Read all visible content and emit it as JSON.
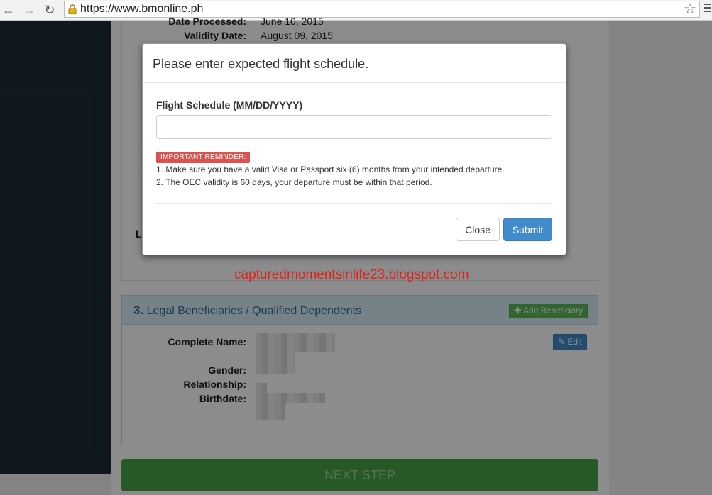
{
  "browser": {
    "url": "https://www.bmonline.ph"
  },
  "panel1": {
    "date_processed_label": "Date Processed:",
    "date_processed_value": "June 10, 2015",
    "validity_label": "Validity Date:",
    "validity_value": "August 09, 2015",
    "partial_label": "L"
  },
  "watermark": "capturedmomentsinlife23.blogspot.com",
  "beneficiaries": {
    "number": "3.",
    "title": "Legal Beneficiaries / Qualified Dependents",
    "add_label": "Add Beneficiary",
    "edit_label": "Edit",
    "fields": {
      "name": "Complete Name:",
      "gender": "Gender:",
      "relationship": "Relationship:",
      "birthdate": "Birthdate:"
    }
  },
  "next_step_label": "NEXT STEP",
  "modal": {
    "title": "Please enter expected flight schedule.",
    "field_label": "Flight Schedule (MM/DD/YYYY)",
    "field_value": "",
    "reminder_badge": "IMPORTANT REMINDER:",
    "notes": [
      "1. Make sure you have a valid Visa or Passport six (6) months from your intended departure.",
      "2. The OEC validity is 60 days, your departure must be within that period."
    ],
    "close_label": "Close",
    "submit_label": "Submit"
  },
  "icons": {
    "back": "arrow-left-icon",
    "forward": "arrow-right-icon",
    "reload": "reload-icon",
    "bookmark": "star-icon",
    "menu": "hamburger-menu-icon",
    "lock": "lock-icon",
    "add": "plus-icon",
    "edit": "edit-icon"
  },
  "colors": {
    "sidebar": "#1e2b3a",
    "success": "#5cb85c",
    "primary": "#428bca",
    "danger": "#d9534f",
    "watermark": "#e0201c"
  }
}
